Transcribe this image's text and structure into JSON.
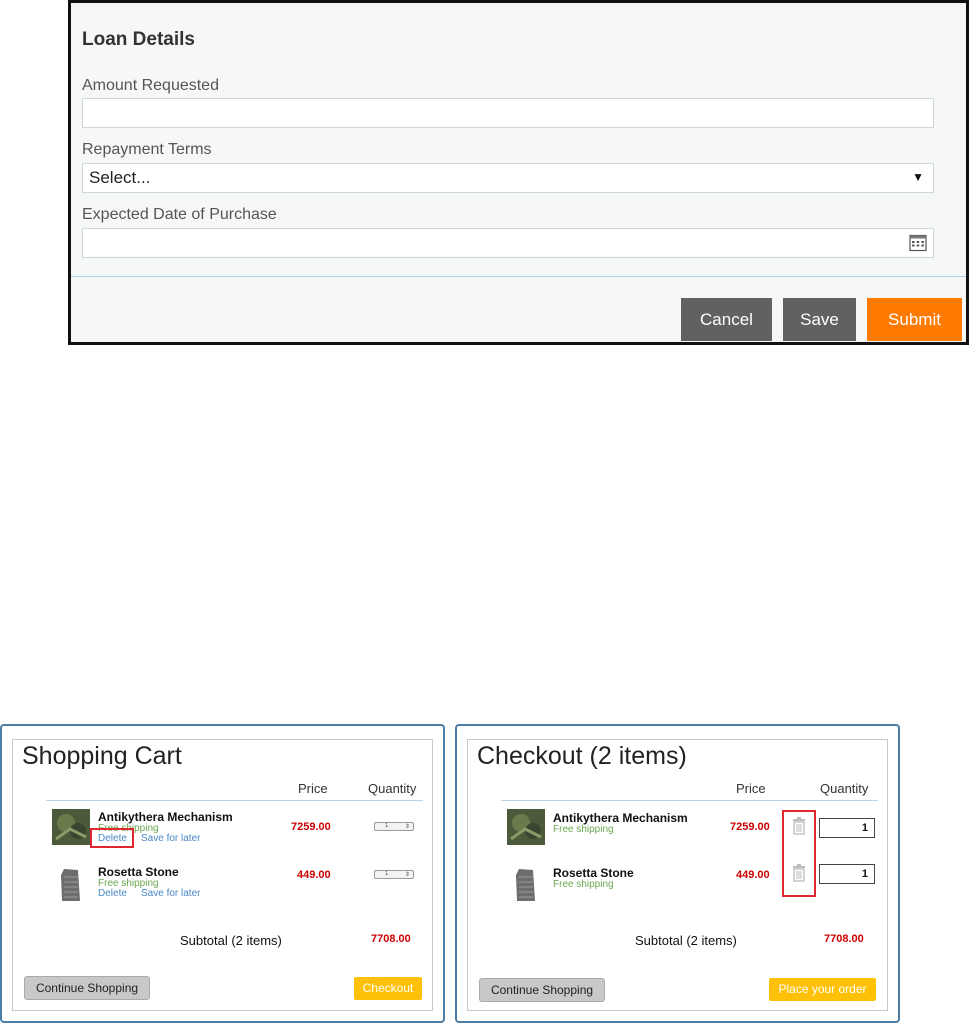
{
  "loan_form": {
    "title": "Loan Details",
    "amount_label": "Amount Requested",
    "amount_value": "",
    "repayment_label": "Repayment Terms",
    "repayment_value": "Select...",
    "date_label": "Expected Date of Purchase",
    "date_value": "",
    "cancel_label": "Cancel",
    "save_label": "Save",
    "submit_label": "Submit",
    "colors": {
      "primary_button": "#ff7a00",
      "secondary_button": "#616161"
    }
  },
  "cart": {
    "title": "Shopping Cart",
    "price_header": "Price",
    "quantity_header": "Quantity",
    "items": [
      {
        "name": "Antikythera Mechanism",
        "shipping": "Free shipping",
        "delete_label": "Delete",
        "save_label": "Save for later",
        "price": "7259.00",
        "quantity": "1"
      },
      {
        "name": "Rosetta Stone",
        "shipping": "Free shipping",
        "delete_label": "Delete",
        "save_label": "Save for later",
        "price": "449.00",
        "quantity": "1"
      }
    ],
    "subtotal_label": "Subtotal (2 items)",
    "subtotal_value": "7708.00",
    "continue_label": "Continue Shopping",
    "checkout_label": "Checkout"
  },
  "checkout": {
    "title": "Checkout (2 items)",
    "price_header": "Price",
    "quantity_header": "Quantity",
    "items": [
      {
        "name": "Antikythera Mechanism",
        "shipping": "Free shipping",
        "price": "7259.00",
        "quantity": "1"
      },
      {
        "name": "Rosetta Stone",
        "shipping": "Free shipping",
        "price": "449.00",
        "quantity": "1"
      }
    ],
    "subtotal_label": "Subtotal (2 items)",
    "subtotal_value": "7708.00",
    "continue_label": "Continue Shopping",
    "place_order_label": "Place your order"
  },
  "icons": {
    "calendar": "calendar-icon",
    "dropdown": "dropdown-arrow-icon",
    "trash": "trash-icon"
  },
  "highlight_color": "#e0262e"
}
